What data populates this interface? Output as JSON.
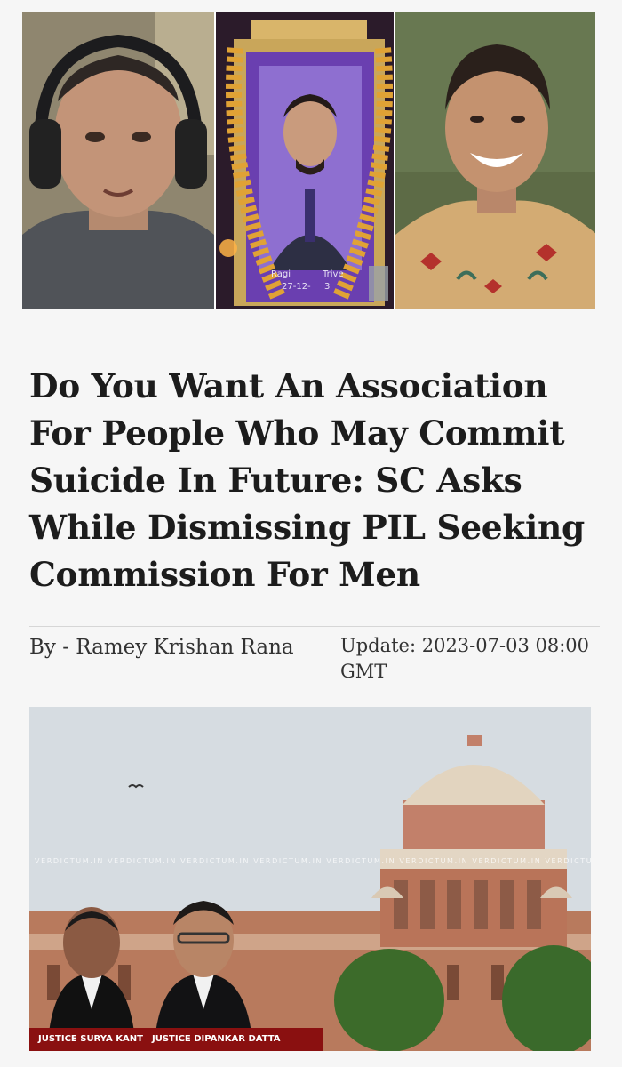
{
  "photo_strip": {
    "frame_text_name": "Ragi",
    "frame_text_name2": "Trive",
    "frame_text_date": "27-12-",
    "frame_text_date2": "3"
  },
  "article": {
    "headline": "Do You Want An Association For People Who May Commit Suicide In Future: SC Asks While Dismissing PIL Seeking Commission For Men",
    "byline": "By - Ramey Krishan Rana",
    "update": "Update: 2023-07-03 08:00 GMT"
  },
  "hero": {
    "watermark": "VERDICTUM.IN  VERDICTUM.IN  VERDICTUM.IN  VERDICTUM.IN  VERDICTUM.IN  VERDICTUM.IN  VERDICTUM.IN  VERDICTUM.IN",
    "caption_1": "JUSTICE SURYA KANT",
    "caption_2": "JUSTICE DIPANKAR DATTA"
  }
}
